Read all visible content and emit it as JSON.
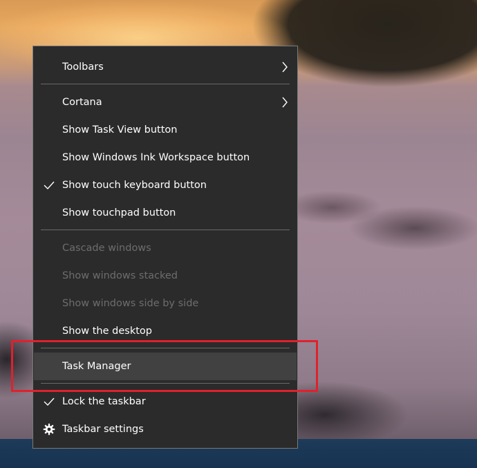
{
  "context_menu": {
    "items": [
      {
        "label": "Toolbars",
        "submenu": true
      },
      {
        "label": "Cortana",
        "submenu": true
      },
      {
        "label": "Show Task View button"
      },
      {
        "label": "Show Windows Ink Workspace button"
      },
      {
        "label": "Show touch keyboard button",
        "checked": true
      },
      {
        "label": "Show touchpad button"
      },
      {
        "label": "Cascade windows",
        "disabled": true
      },
      {
        "label": "Show windows stacked",
        "disabled": true
      },
      {
        "label": "Show windows side by side",
        "disabled": true
      },
      {
        "label": "Show the desktop"
      },
      {
        "label": "Task Manager",
        "highlighted": true
      },
      {
        "label": "Lock the taskbar",
        "checked": true
      },
      {
        "label": "Taskbar settings",
        "icon": "gear-icon"
      }
    ]
  },
  "colors": {
    "menu_background": "#2b2b2b",
    "menu_text": "#ffffff",
    "disabled_text": "#6d6d6d",
    "hover_background": "#414141",
    "annotation_red": "#e0212c",
    "taskbar": "#1d3c5a"
  },
  "icons": {
    "submenu": "chevron-right-icon",
    "check": "checkmark-icon",
    "settings": "gear-icon"
  }
}
